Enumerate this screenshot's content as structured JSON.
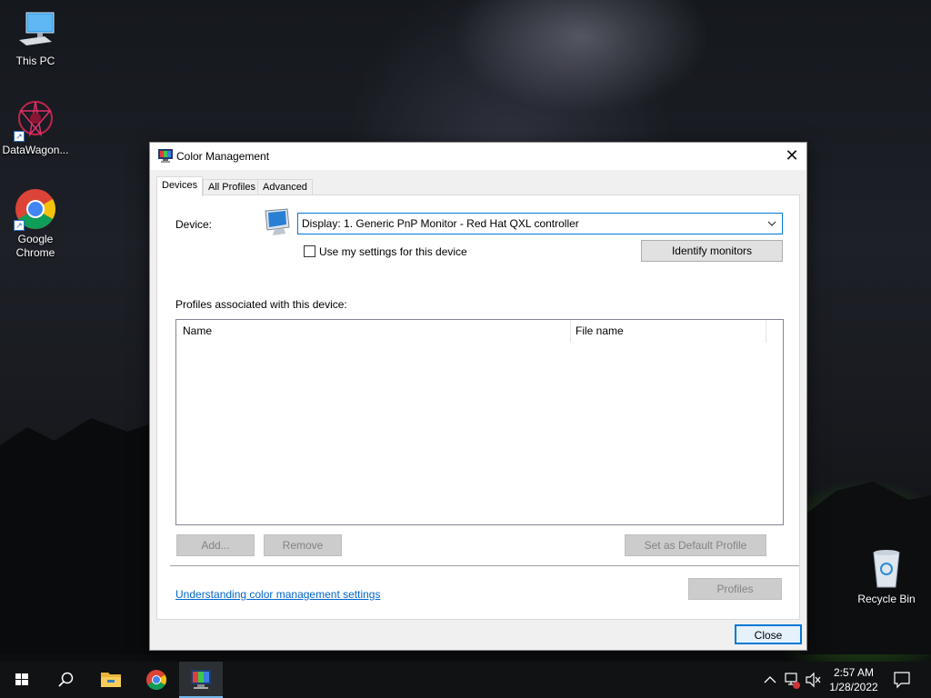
{
  "desktop": {
    "icons": [
      {
        "label": "This PC"
      },
      {
        "label": "DataWagon..."
      },
      {
        "label": "Google Chrome"
      },
      {
        "label": "Recycle Bin"
      }
    ]
  },
  "dialog": {
    "title": "Color Management",
    "tabs": [
      {
        "label": "Devices",
        "active": true
      },
      {
        "label": "All Profiles",
        "active": false
      },
      {
        "label": "Advanced",
        "active": false
      }
    ],
    "device_label": "Device:",
    "device_value": "Display: 1. Generic PnP Monitor - Red Hat QXL controller",
    "use_settings_label": "Use my settings for this device",
    "use_settings_checked": false,
    "identify_button": "Identify monitors",
    "profiles_label": "Profiles associated with this device:",
    "profiles_columns": [
      "Name",
      "File name"
    ],
    "profiles_rows": [],
    "add_button": "Add...",
    "remove_button": "Remove",
    "set_default_button": "Set as Default Profile",
    "link_text": "Understanding color management settings",
    "profiles_button": "Profiles",
    "close_button": "Close"
  },
  "taskbar": {
    "time": "2:57 AM",
    "date": "1/28/2022",
    "accent": "#76b9ed"
  }
}
